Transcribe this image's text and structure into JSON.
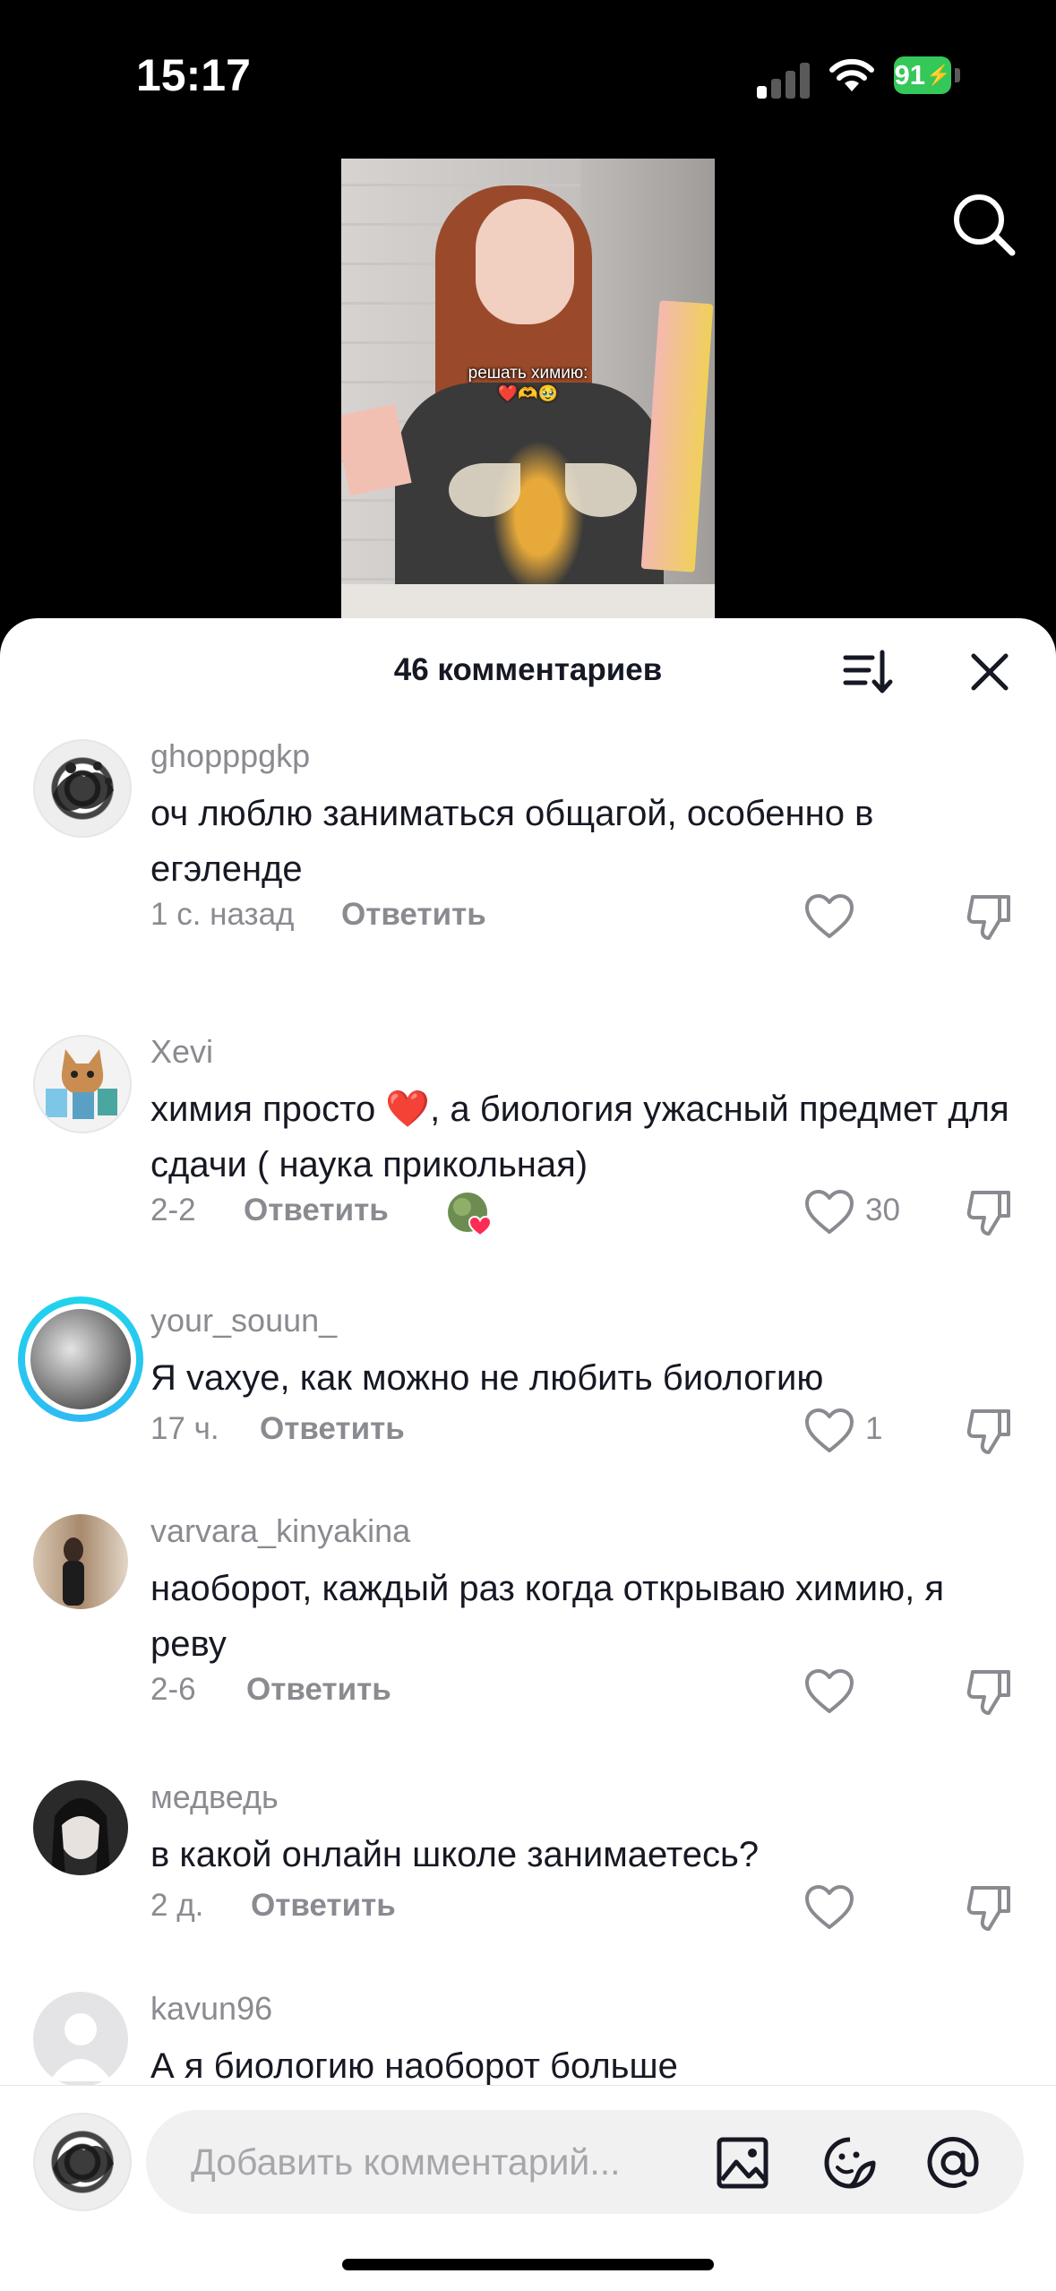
{
  "status_bar": {
    "time": "15:17",
    "battery": "91"
  },
  "video": {
    "caption": "решать химию:",
    "caption_emoji": "❤️🫶🥹"
  },
  "sheet": {
    "title": "46 комментариев"
  },
  "comments": [
    {
      "username": "ghopppgkp",
      "text": "оч люблю заниматься общагой, особенно в егэленде",
      "time": "1 с. назад",
      "reply": "Ответить",
      "likes": ""
    },
    {
      "username": "Xevi",
      "text_before": "химия просто",
      "text_emoji": "❤️",
      "text_after": ", а биология ужасный предмет для сдачи ( наука прикольная)",
      "time": "2-2",
      "reply": "Ответить",
      "likes": "30"
    },
    {
      "username": "your_souun_",
      "text": "Я vaxye, как можно не любить биологию",
      "time": "17 ч.",
      "reply": "Ответить",
      "likes": "1"
    },
    {
      "username": "varvara_kinyakina",
      "text": "наоборот, каждый раз когда открываю химию, я реву",
      "time": "2-6",
      "reply": "Ответить",
      "likes": ""
    },
    {
      "username": "медведь",
      "text": "в какой онлайн школе занимаетесь?",
      "time": "2 д.",
      "reply": "Ответить",
      "likes": ""
    },
    {
      "username": "kavun96",
      "text": "А я биологию наоборот больше"
    }
  ],
  "comment_input": {
    "placeholder": "Добавить комментарий..."
  }
}
